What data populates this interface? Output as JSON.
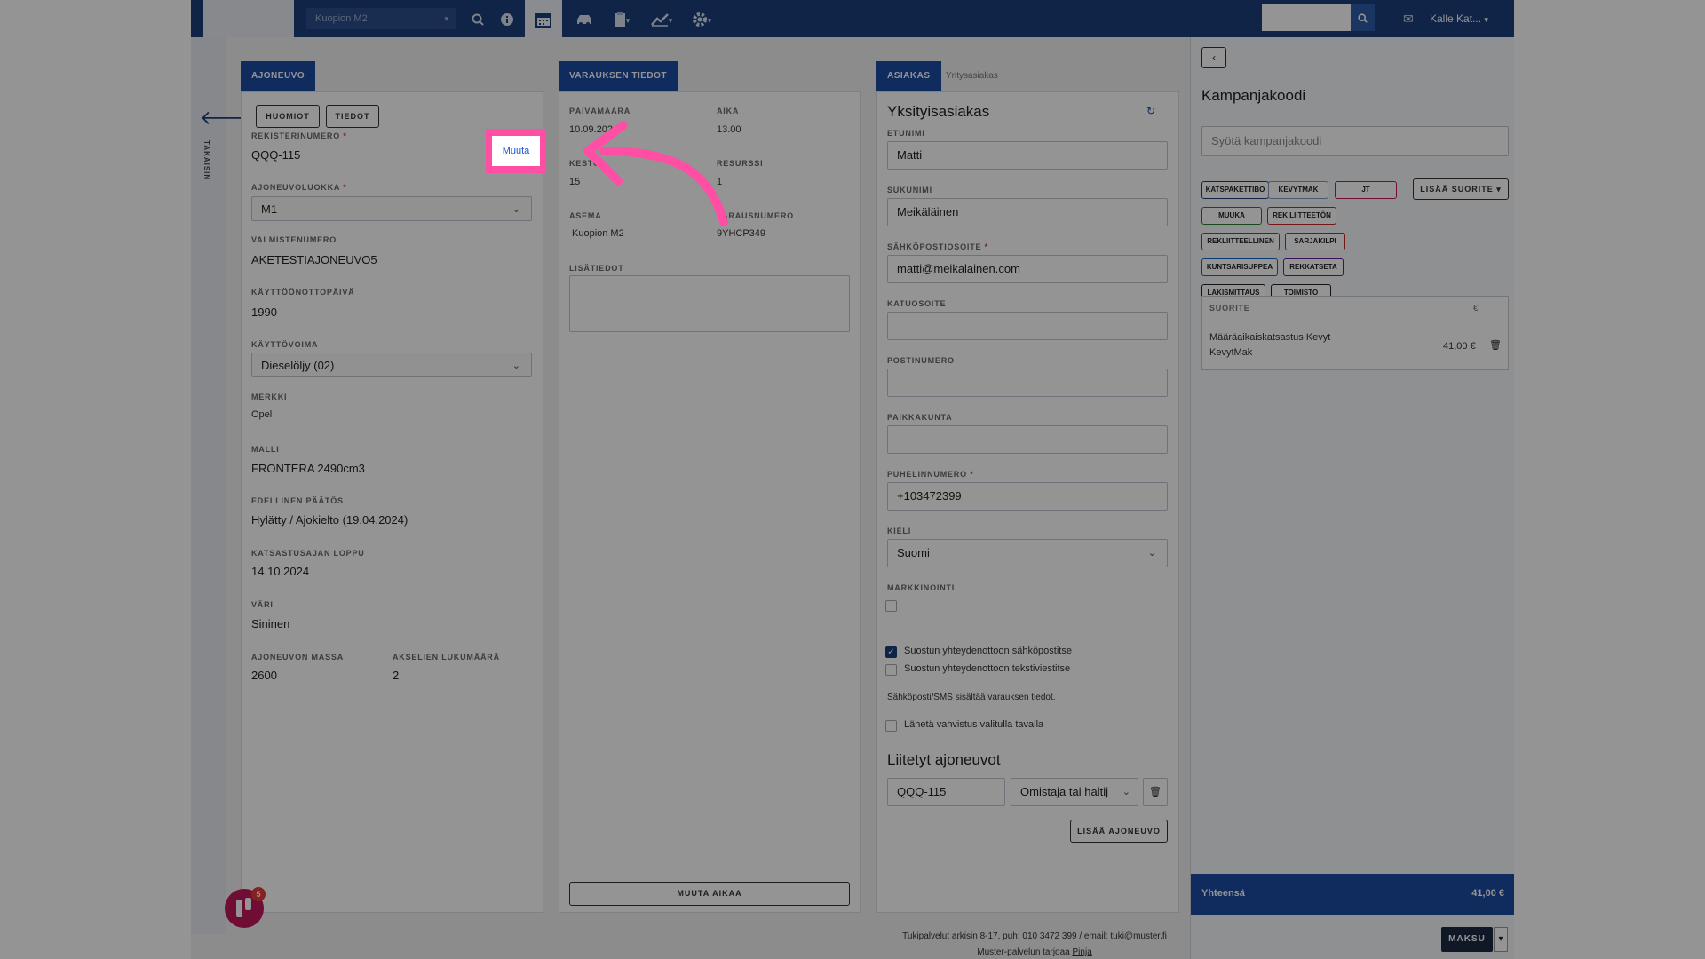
{
  "topbar": {
    "location": "Kuopion M2",
    "user": "Kalle Kat...",
    "icons": [
      "search-icon",
      "info-icon",
      "calendar-icon",
      "car-icon",
      "clipboard-icon",
      "chart-icon",
      "gear-icon",
      "mail-icon"
    ]
  },
  "sidebar": {
    "back_label": "TAKAISIN"
  },
  "vehicle": {
    "tab": "AJONEUVO",
    "btn_notes": "HUOMIOT",
    "btn_info": "TIEDOT",
    "reg_label": "REKISTERINUMERO",
    "reg_value": "QQQ-115",
    "change_link": "Muuta",
    "class_label": "AJONEUVOLUOKKA",
    "class_value": "M1",
    "serial_label": "VALMISTENUMERO",
    "serial_value": "AKETESTIAJONEUVO5",
    "firstuse_label": "KÄYTTÖÖNOTTOPÄIVÄ",
    "firstuse_value": "1990",
    "fuel_label": "KÄYTTÖVOIMA",
    "fuel_value": "Dieselöljy (02)",
    "make_label": "MERKKI",
    "make_value": "Opel",
    "model_label": "MALLI",
    "model_value": "FRONTERA 2490cm3",
    "prev_label": "EDELLINEN PÄÄTÖS",
    "prev_value": "Hylätty / Ajokielto (19.04.2024)",
    "end_label": "KATSASTUSAJAN LOPPU",
    "end_value": "14.10.2024",
    "color_label": "VÄRI",
    "color_value": "Sininen",
    "mass_label": "AJONEUVON MASSA",
    "mass_value": "2600",
    "axles_label": "AKSELIEN LUKUMÄÄRÄ",
    "axles_value": "2"
  },
  "booking": {
    "tab": "VARAUKSEN TIEDOT",
    "date_label": "PÄIVÄMÄÄRÄ",
    "date_value": "10.09.2024",
    "time_label": "AIKA",
    "time_value": "13.00",
    "duration_label": "KESTO",
    "duration_value": "15",
    "resource_label": "RESURSSI",
    "resource_value": "1",
    "station_label": "ASEMA",
    "station_value": "Kuopion M2",
    "bookingno_label": "VARAUSNUMERO",
    "bookingno_value": "9YHCP349",
    "extra_label": "LISÄTIEDOT",
    "change_time_btn": "MUUTA AIKAA"
  },
  "customer": {
    "tab": "ASIAKAS",
    "tab2": "Yritysasiakas",
    "heading": "Yksityisasiakas",
    "firstname_label": "ETUNIMI",
    "firstname_value": "Matti",
    "lastname_label": "SUKUNIMI",
    "lastname_value": "Meikäläinen",
    "email_label": "SÄHKÖPOSTIOSOITE",
    "email_value": "matti@meikalainen.com",
    "street_label": "KATUOSOITE",
    "postal_label": "POSTINUMERO",
    "city_label": "PAIKKAKUNTA",
    "phone_label": "PUHELINNUMERO",
    "phone_value": "+103472399",
    "lang_label": "KIELI",
    "lang_value": "Suomi",
    "marketing_label": "MARKKINOINTI",
    "consent_email": "Suostun yhteydenottoon sähköpostitse",
    "consent_sms": "Suostun yhteydenottoon tekstiviestitse",
    "info_note": "Sähköposti/SMS sisältää varauksen tiedot.",
    "send_confirm": "Lähetä vahvistus valitulla tavalla",
    "linked_heading": "Liitetyt ajoneuvot",
    "linked_reg": "QQQ-115",
    "linked_role": "Omistaja tai haltij",
    "add_vehicle_btn": "LISÄÄ AJONEUVO"
  },
  "campaign": {
    "heading": "Kampanjakoodi",
    "placeholder": "Syötä kampanjakoodi",
    "add_service_btn": "LISÄÄ SUORITE",
    "chips": [
      {
        "label": "KATSPAKETTIBO",
        "color": "#1d3f7a"
      },
      {
        "label": "KEVYTMAK",
        "color": "#7a9cc8"
      },
      {
        "label": "JT",
        "color": "#c2185b"
      },
      {
        "label": "MUUKA",
        "color": "#2e7d32"
      },
      {
        "label": "REK LIITTEETÖN",
        "color": "#c62828"
      },
      {
        "label": "REKLIITTEELLINEN",
        "color": "#c62828"
      },
      {
        "label": "SARJAKILPI",
        "color": "#c62828"
      },
      {
        "label": "KUNTSARISUPPEA",
        "color": "#1565c0"
      },
      {
        "label": "REKKATSETA",
        "color": "#6a1b9a"
      },
      {
        "label": "LAKISMITTAUS",
        "color": "#222222"
      },
      {
        "label": "TOIMISTO",
        "color": "#222222"
      }
    ],
    "table_header": "SUORITE",
    "table_currency": "€",
    "service_name": "Määräaikaiskatsastus Kevyt KevytMak",
    "service_price": "41,00 €",
    "total_label": "Yhteensä",
    "total_value": "41,00 €",
    "pay_btn": "MAKSU"
  },
  "footer": {
    "line1": "Tukipalvelut arkisin 8-17, puh: 010 3472 399 / email: tuki@muster.fi",
    "line2_prefix": "Muster-palvelun tarjoaa ",
    "line2_link": "Pinja"
  },
  "chat_badge": {
    "count": "5"
  }
}
